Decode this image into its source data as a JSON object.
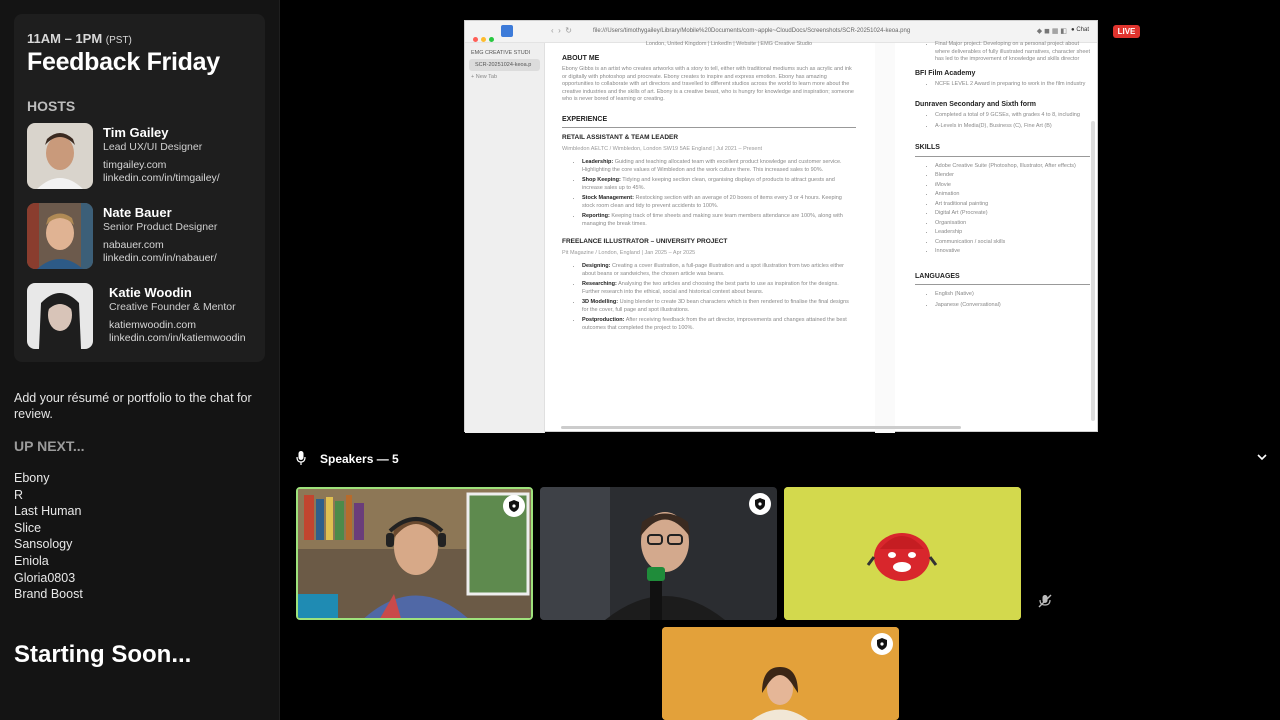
{
  "stream": {
    "time": "11AM – 1PM",
    "timezone": "(PST)",
    "title": "Feedback Friday",
    "hosts_label": "HOSTS",
    "hosts": [
      {
        "name": "Tim Gailey",
        "role": "Lead UX/UI Designer",
        "site": "timgailey.com",
        "linkedin": "linkedin.com/in/timgailey/"
      },
      {
        "name": "Nate Bauer",
        "role": "Senior Product Designer",
        "site": "nabauer.com",
        "linkedin": "linkedin.com/in/nabauer/"
      },
      {
        "name": "Katie Woodin",
        "role": "Creative Founder & Mentor",
        "site": "katiemwoodin.com",
        "linkedin": "linkedin.com/in/katiemwoodin"
      }
    ],
    "review_note": "Add your résumé or portfolio to the chat for review.",
    "up_next_label": "UP NEXT...",
    "queue": [
      "Ebony",
      "R",
      "Last Human",
      "Slice",
      "Sansology",
      "Eniola",
      "Gloria0803",
      "Brand Boost"
    ],
    "starting_soon": "Starting Soon..."
  },
  "live_badge": "LIVE",
  "browser": {
    "url": "file:///Users/timothygailey/Library/Mobile%20Documents/com~apple~CloudDocs/Screenshots/SCR-20251024-keoa.png",
    "sidebar": [
      "EMG CREATIVE STUDI",
      "SCR-20251024-keoa.p",
      "New Tab"
    ],
    "chat": "Chat"
  },
  "resume": {
    "header_line": "London, United Kingdom | LinkedIn | Website | EMG Creative Studio",
    "about_heading": "ABOUT ME",
    "about_text": "Ebony Gibbs is an artist who creates artworks with a story to tell, either with traditional mediums such as acrylic and ink or digitally with photoshop and procreate. Ebony creates to inspire and express emotion. Ebony has amazing opportunities to collaborate with art directors and travelled to different studios across the world to learn more about the creative industries and the skills of art. Ebony is a creative beast, who is hungry for knowledge and inspiration; someone who is never bored of learning or creating.",
    "experience_heading": "EXPERIENCE",
    "job1_title": "RETAIL ASSISTANT & TEAM LEADER",
    "job1_sub": "Wimbledon AELTC / Wimbledon, London SW19 5AE England | Jul 2021 – Present",
    "job1_items": [
      {
        "label": "Leadership:",
        "text": "Guiding and teaching allocated team with excellent product knowledge and customer service. Highlighting the core values of Wimbledon and the work culture there. This increased sales to 90%."
      },
      {
        "label": "Shop Keeping:",
        "text": "Tidying and keeping section clean, organising displays of products to attract guests and increase sales up to 45%."
      },
      {
        "label": "Stock Management:",
        "text": "Restocking section with an average of 20 boxes of items every 3 or 4 hours. Keeping stock room clean and tidy to prevent accidents to 100%."
      },
      {
        "label": "Reporting:",
        "text": "Keeping track of time sheets and making sure team members attendance are 100%, along with managing the break times."
      }
    ],
    "job2_title": "FREELANCE ILLUSTRATOR – UNIVERSITY PROJECT",
    "job2_sub": "Pit Magazine / London, England | Jan 2025 – Apr 2025",
    "job2_items": [
      {
        "label": "Designing:",
        "text": "Creating a cover illustration, a full-page illustration and a spot illustration from two articles either about beans or sandwiches, the chosen article was beans."
      },
      {
        "label": "Researching:",
        "text": "Analysing the two articles and choosing the best parts to use as inspiration for the designs. Further research into the ethical, social and historical context about beans."
      },
      {
        "label": "3D Modelling:",
        "text": "Using blender to create 3D bean characters which is then rendered to finalise the final designs for the cover, full page and spot illustrations."
      },
      {
        "label": "Postproduction:",
        "text": "After receiving feedback from the art director, improvements and changes attained the best outcomes that completed the project to 100%."
      }
    ],
    "right_top_items": [
      "Final Major project: Developing on a personal project about where deliverables of fully illustrated narratives, character sheet has led to the improvement of knowledge and skills director"
    ],
    "edu1": "BFI Film Academy",
    "edu1_items": [
      "NCFE LEVEL 2 Award in preparing to work in the film industry"
    ],
    "edu2": "Dunraven Secondary and Sixth form",
    "edu2_items": [
      "Completed a total of 9 GCSEs, with grades 4 to 8, including",
      "A-Levels in Media(D), Business (C), Fine Art (B)"
    ],
    "skills_heading": "SKILLS",
    "skills": [
      "Adobe Creative Suite (Photoshop, Illustrator, After effects)",
      "Blender",
      "iMovie",
      "Animation",
      "Art traditional painting",
      "Digital Art (Procreate)",
      "Organisation",
      "Leadership",
      "Communication / social skills",
      "Innovative"
    ],
    "languages_heading": "LANGUAGES",
    "languages": [
      "English (Native)",
      "Japanese (Conversational)"
    ]
  },
  "speakers": {
    "label": "Speakers — 5"
  },
  "colors": {
    "active_speaker": "#9ee27c",
    "live": "#e0342e",
    "yellow_tile": "#d3d94d",
    "orange_tile": "#e3a13a"
  }
}
